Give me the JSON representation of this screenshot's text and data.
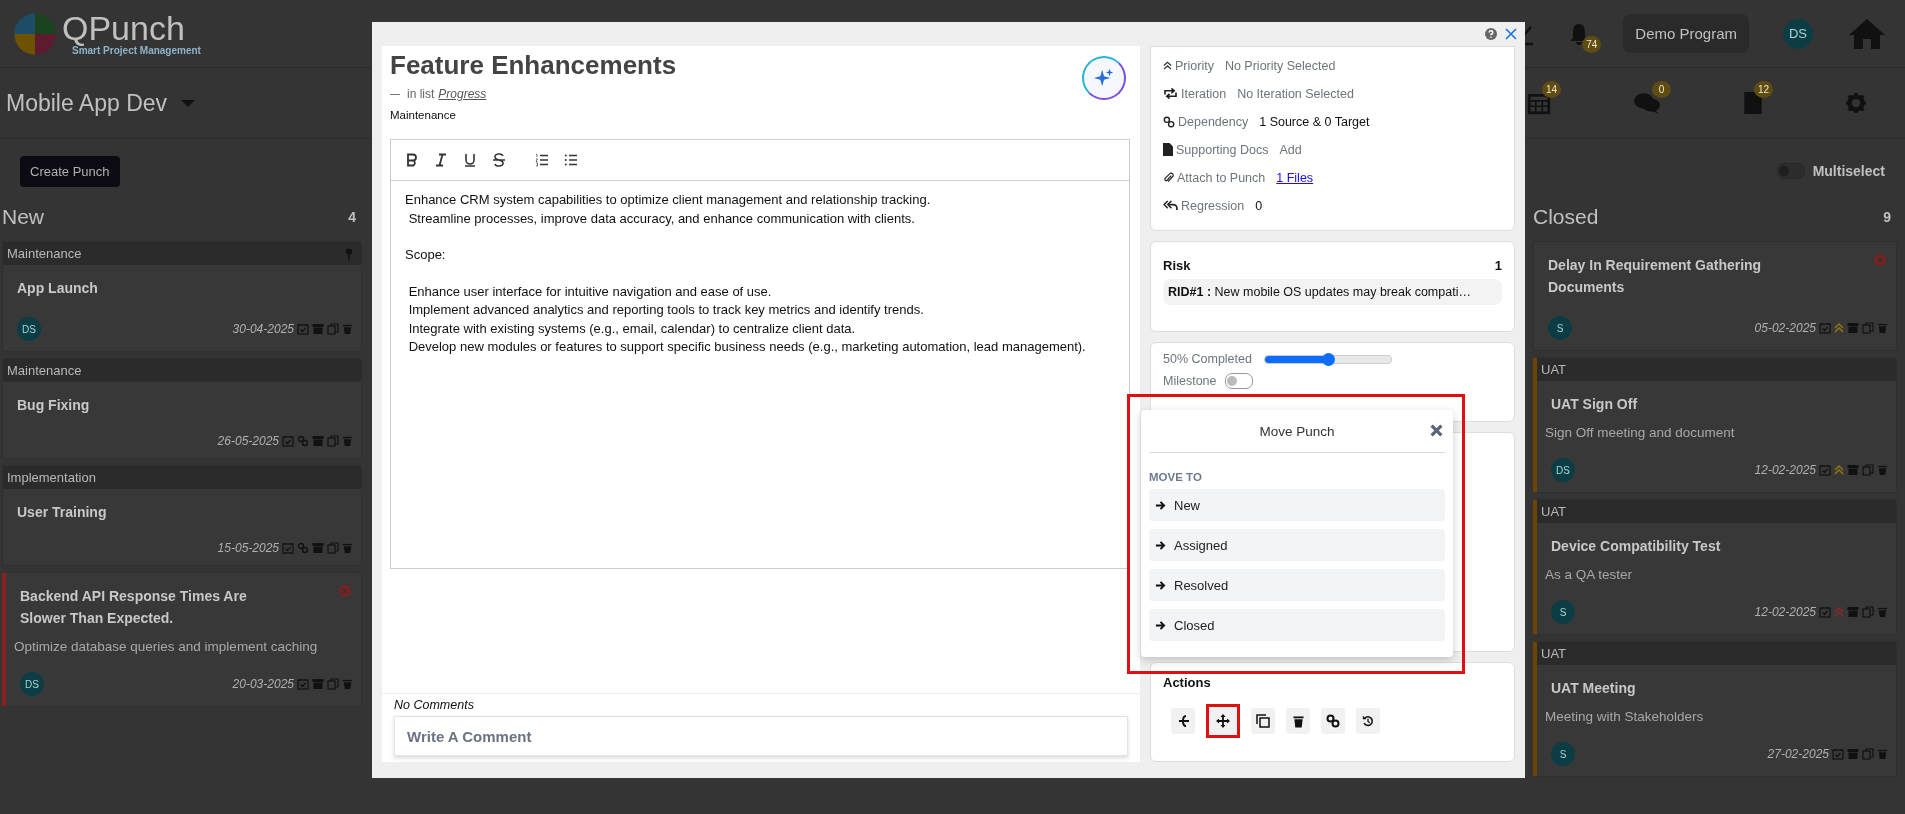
{
  "app": {
    "logo_title": "QPunch",
    "logo_subtitle": "Smart Project Management",
    "notifications": "74",
    "program": "Demo Program",
    "user_initials": "DS"
  },
  "project": {
    "name": "Mobile App Dev",
    "badges": [
      {
        "kind": "calendar",
        "count": "14"
      },
      {
        "kind": "chat",
        "count": "0"
      },
      {
        "kind": "document",
        "count": "12"
      }
    ]
  },
  "toolbar": {
    "create_button": "Create Punch",
    "multiselect": {
      "label": "Multiselect",
      "on": false
    }
  },
  "columns": [
    {
      "title": "New",
      "count": "4",
      "cards": [
        {
          "kind": "task",
          "category": "Maintenance",
          "title": "App Launch",
          "avatar": "DS",
          "date": "30-04-2025",
          "pinned": true,
          "linked": false
        },
        {
          "kind": "task",
          "category": "Maintenance",
          "title": "Bug Fixing",
          "date": "26-05-2025",
          "pinned": false,
          "linked": true
        },
        {
          "kind": "task",
          "category": "Implementation",
          "title": "User Training",
          "date": "15-05-2025",
          "pinned": false,
          "linked": true
        },
        {
          "kind": "risk",
          "color": "#8a2020",
          "title": "Backend API Response Times Are Slower Than Expected.",
          "description": "Optimize database queries and implement caching",
          "avatar": "DS",
          "date": "20-03-2025",
          "pinned": false,
          "linked": false
        }
      ]
    },
    {
      "title": "Closed",
      "count": "9",
      "cards": [
        {
          "kind": "risk",
          "title": "Delay In Requirement Gathering Documents",
          "avatar": "S",
          "date": "05-02-2025",
          "pinned": false,
          "linked": false,
          "priority": {
            "color": "#8a7414"
          }
        },
        {
          "kind": "task",
          "color": "#6e4500",
          "category": "UAT",
          "title": "UAT Sign Off",
          "description": "Sign Off meeting and document",
          "avatar": "DS",
          "date": "12-02-2025",
          "pinned": false,
          "linked": false,
          "priority": {
            "color": "#8a7414"
          }
        },
        {
          "kind": "task",
          "color": "#6e4500",
          "category": "UAT",
          "title": "Device Compatibility Test",
          "description": "As a QA tester",
          "avatar": "S",
          "date": "12-02-2025",
          "pinned": false,
          "linked": false,
          "priority": {
            "color": "#8a2a2a"
          }
        },
        {
          "kind": "task",
          "color": "#6e4500",
          "category": "UAT",
          "title": "UAT Meeting",
          "description": "Meeting with Stakeholders",
          "avatar": "S",
          "date": "27-02-2025",
          "pinned": false,
          "linked": false
        }
      ]
    }
  ],
  "modal": {
    "title": "Feature Enhancements",
    "list_prefix": "in list",
    "list_name": "Progress",
    "category": "Maintenance",
    "description": [
      [
        "Enhance CRM system capabilities to optimize client management and relationship tracking.",
        " Streamline processes, improve data accuracy, and enhance communication with clients."
      ],
      [
        "Scope:"
      ],
      [
        " Enhance user interface for intuitive navigation and ease of use.",
        " Implement advanced analytics and reporting tools to track key metrics and identify trends.",
        " Integrate with existing systems (e.g., email, calendar) to centralize client data.",
        " Develop new modules or features to support specific business needs (e.g., marketing automation, lead management)."
      ]
    ],
    "comments_label": "No Comments",
    "comment_placeholder": "Write A Comment",
    "details": [
      {
        "kind": "priority",
        "label": "Priority",
        "value": "No Priority Selected",
        "muted": true,
        "link": false
      },
      {
        "kind": "iteration",
        "label": "Iteration",
        "value": "No Iteration Selected",
        "muted": true,
        "link": false
      },
      {
        "kind": "dependency",
        "label": "Dependency",
        "value": "1 Source & 0 Target",
        "muted": false,
        "link": false
      },
      {
        "kind": "document",
        "label": "Supporting Docs",
        "value": "Add",
        "muted": true,
        "link": false
      },
      {
        "kind": "attachment",
        "label": "Attach to Punch",
        "value": "1 Files",
        "muted": false,
        "link": true
      },
      {
        "kind": "regression",
        "label": "Regression",
        "value": "0",
        "muted": false,
        "link": false
      }
    ],
    "risk": {
      "title": "Risk",
      "count": "1",
      "items": [
        {
          "id": "RID#1 :",
          "text": "New mobile OS updates may break compati…"
        }
      ]
    },
    "progress": {
      "label": "50% Completed",
      "level": 0.5
    },
    "milestone": {
      "label": "Milestone",
      "on": false
    },
    "actions": {
      "title": "Actions",
      "buttons": [
        {
          "kind": "branch",
          "highlighted": false
        },
        {
          "kind": "move",
          "highlighted": true
        },
        {
          "kind": "copy",
          "highlighted": false
        },
        {
          "kind": "trash",
          "highlighted": false
        },
        {
          "kind": "link",
          "highlighted": false
        },
        {
          "kind": "history",
          "highlighted": false
        }
      ]
    },
    "move_popup": {
      "title": "Move Punch",
      "section": "MOVE TO",
      "options": [
        "New",
        "Assigned",
        "Resolved",
        "Closed"
      ],
      "highlighted": true
    }
  }
}
